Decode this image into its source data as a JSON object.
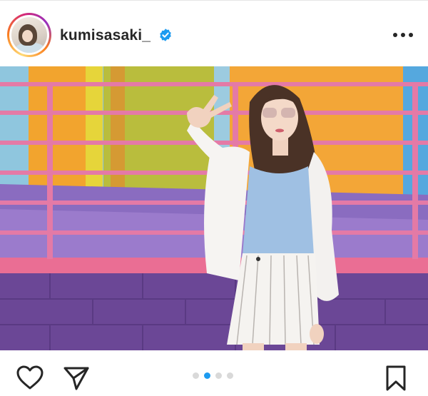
{
  "header": {
    "username": "kumisasaki_",
    "verified": true,
    "avatar_icon": "profile-avatar",
    "more_icon": "more-horizontal-icon"
  },
  "post": {
    "media_type": "photo",
    "carousel": {
      "total": 4,
      "active_index": 1
    }
  },
  "actions": {
    "like_icon": "heart-icon",
    "share_icon": "paper-plane-icon",
    "save_icon": "bookmark-icon"
  },
  "colors": {
    "verified_blue": "#1d9bf0",
    "carousel_active": "#1d9bf0",
    "carousel_inactive": "#d9d9d9",
    "text_primary": "#262626"
  }
}
